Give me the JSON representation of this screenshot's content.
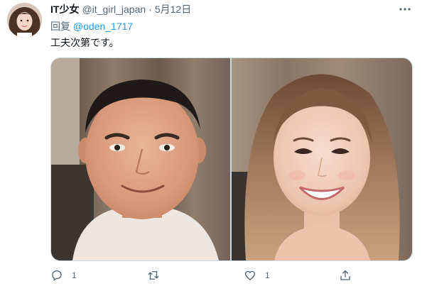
{
  "tweet": {
    "display_name": "IT少女",
    "handle": "@it_girl_japan",
    "separator": "·",
    "date": "5月12日",
    "reply_prefix": "回复",
    "reply_to": "@oden_1717",
    "text": "工夫次第です。"
  },
  "media": {
    "left_photo": "man-photo",
    "right_photo": "woman-photo"
  },
  "actions": {
    "reply_count": "1",
    "retweet_count": "",
    "like_count": "1"
  },
  "colors": {
    "accent": "#1d9bf0",
    "secondary_text": "#536471",
    "primary_text": "#0f1419",
    "border": "#cfd9de"
  },
  "icons": [
    "more-icon",
    "reply-icon",
    "retweet-icon",
    "like-icon",
    "share-icon"
  ]
}
